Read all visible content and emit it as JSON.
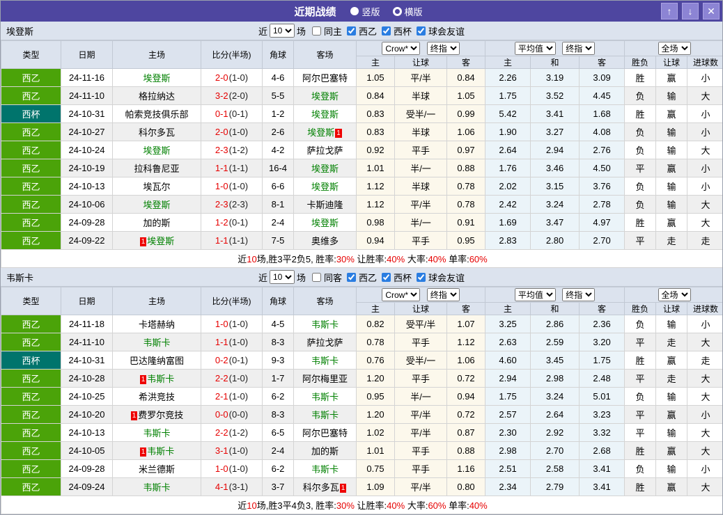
{
  "titlebar": {
    "title": "近期战绩",
    "view_options": [
      {
        "label": "竖版",
        "selected": true
      },
      {
        "label": "横版",
        "selected": false
      }
    ],
    "icons": {
      "up": "↑",
      "down": "↓",
      "close": "✕"
    }
  },
  "colors": {
    "titlebar_purple": "#4e46a0",
    "league_green": "#4ba309",
    "cup_teal": "#00746c",
    "team_highlight_green": "#008000",
    "win_red": "#e60000",
    "draw_green": "#009944",
    "loss_blue": "#2828d0",
    "handicap_col_bg": "#fcf8ec",
    "avg_col_bg": "#ebf4f9"
  },
  "sections": [
    {
      "team": "埃登斯",
      "filter": {
        "near": "近",
        "count": "10",
        "games": "场",
        "same": {
          "label": "同主",
          "checked": false
        },
        "leagues": [
          {
            "label": "西乙",
            "checked": true
          },
          {
            "label": "西杯",
            "checked": true
          },
          {
            "label": "球会友谊",
            "checked": true
          }
        ]
      },
      "columns": {
        "type": "类型",
        "date": "日期",
        "home": "主场",
        "score": "比分(半场)",
        "corner": "角球",
        "away": "客场",
        "crow_select": "Crow*",
        "final_select": "终指",
        "crow_sub": [
          "主",
          "让球",
          "客"
        ],
        "avg_select": "平均值",
        "avg_final_select": "终指",
        "avg_sub": [
          "主",
          "和",
          "客"
        ],
        "scope_select": "全场",
        "result_sub": [
          "胜负",
          "让球",
          "进球数"
        ]
      },
      "rows": [
        {
          "league": "西乙",
          "lc": "green",
          "date": "24-11-16",
          "home": {
            "name": "埃登斯",
            "hl": true
          },
          "score": "2-0",
          "half": "(1-0)",
          "corner": "4-6",
          "away": {
            "name": "阿尔巴塞特",
            "hl": false
          },
          "crow": [
            "1.05",
            "平/半",
            "0.84"
          ],
          "avg": [
            "2.26",
            "3.19",
            "3.09"
          ],
          "result": [
            [
              "胜",
              "r"
            ],
            [
              "赢",
              "r"
            ],
            [
              "小",
              "b"
            ]
          ]
        },
        {
          "league": "西乙",
          "lc": "green",
          "date": "24-11-10",
          "home": {
            "name": "格拉纳达",
            "hl": false
          },
          "score": "3-2",
          "half": "(2-0)",
          "corner": "5-5",
          "away": {
            "name": "埃登斯",
            "hl": true
          },
          "crow": [
            "0.84",
            "半球",
            "1.05"
          ],
          "avg": [
            "1.75",
            "3.52",
            "4.45"
          ],
          "result": [
            [
              "负",
              "b"
            ],
            [
              "输",
              "b"
            ],
            [
              "大",
              "r"
            ]
          ]
        },
        {
          "league": "西杯",
          "lc": "teal",
          "date": "24-10-31",
          "home": {
            "name": "帕索竞技俱乐部",
            "hl": false
          },
          "score": "0-1",
          "half": "(0-1)",
          "corner": "1-2",
          "away": {
            "name": "埃登斯",
            "hl": true
          },
          "crow": [
            "0.83",
            "受半/一",
            "0.99"
          ],
          "avg": [
            "5.42",
            "3.41",
            "1.68"
          ],
          "result": [
            [
              "胜",
              "r"
            ],
            [
              "赢",
              "r"
            ],
            [
              "小",
              "b"
            ]
          ]
        },
        {
          "league": "西乙",
          "lc": "green",
          "date": "24-10-27",
          "home": {
            "name": "科尔多瓦",
            "hl": false
          },
          "score": "2-0",
          "half": "(1-0)",
          "corner": "2-6",
          "away": {
            "name": "埃登斯",
            "hl": true,
            "badge_post": "1"
          },
          "crow": [
            "0.83",
            "半球",
            "1.06"
          ],
          "avg": [
            "1.90",
            "3.27",
            "4.08"
          ],
          "result": [
            [
              "负",
              "b"
            ],
            [
              "输",
              "b"
            ],
            [
              "小",
              "b"
            ]
          ]
        },
        {
          "league": "西乙",
          "lc": "green",
          "date": "24-10-24",
          "home": {
            "name": "埃登斯",
            "hl": true
          },
          "score": "2-3",
          "half": "(1-2)",
          "corner": "4-2",
          "away": {
            "name": "萨拉戈萨",
            "hl": false
          },
          "crow": [
            "0.92",
            "平手",
            "0.97"
          ],
          "avg": [
            "2.64",
            "2.94",
            "2.76"
          ],
          "result": [
            [
              "负",
              "b"
            ],
            [
              "输",
              "b"
            ],
            [
              "大",
              "r"
            ]
          ]
        },
        {
          "league": "西乙",
          "lc": "green",
          "date": "24-10-19",
          "home": {
            "name": "拉科鲁尼亚",
            "hl": false
          },
          "score": "1-1",
          "half": "(1-1)",
          "corner": "16-4",
          "away": {
            "name": "埃登斯",
            "hl": true
          },
          "crow": [
            "1.01",
            "半/一",
            "0.88"
          ],
          "avg": [
            "1.76",
            "3.46",
            "4.50"
          ],
          "result": [
            [
              "平",
              "g"
            ],
            [
              "赢",
              "r"
            ],
            [
              "小",
              "b"
            ]
          ]
        },
        {
          "league": "西乙",
          "lc": "green",
          "date": "24-10-13",
          "home": {
            "name": "埃瓦尔",
            "hl": false
          },
          "score": "1-0",
          "half": "(1-0)",
          "corner": "6-6",
          "away": {
            "name": "埃登斯",
            "hl": true
          },
          "crow": [
            "1.12",
            "半球",
            "0.78"
          ],
          "avg": [
            "2.02",
            "3.15",
            "3.76"
          ],
          "result": [
            [
              "负",
              "b"
            ],
            [
              "输",
              "b"
            ],
            [
              "小",
              "b"
            ]
          ]
        },
        {
          "league": "西乙",
          "lc": "green",
          "date": "24-10-06",
          "home": {
            "name": "埃登斯",
            "hl": true
          },
          "score": "2-3",
          "half": "(2-3)",
          "corner": "8-1",
          "away": {
            "name": "卡斯迪隆",
            "hl": false
          },
          "crow": [
            "1.12",
            "平/半",
            "0.78"
          ],
          "avg": [
            "2.42",
            "3.24",
            "2.78"
          ],
          "result": [
            [
              "负",
              "b"
            ],
            [
              "输",
              "b"
            ],
            [
              "大",
              "r"
            ]
          ]
        },
        {
          "league": "西乙",
          "lc": "green",
          "date": "24-09-28",
          "home": {
            "name": "加的斯",
            "hl": false
          },
          "score": "1-2",
          "half": "(0-1)",
          "corner": "2-4",
          "away": {
            "name": "埃登斯",
            "hl": true
          },
          "crow": [
            "0.98",
            "半/一",
            "0.91"
          ],
          "avg": [
            "1.69",
            "3.47",
            "4.97"
          ],
          "result": [
            [
              "胜",
              "r"
            ],
            [
              "赢",
              "r"
            ],
            [
              "大",
              "r"
            ]
          ]
        },
        {
          "league": "西乙",
          "lc": "green",
          "date": "24-09-22",
          "home": {
            "name": "埃登斯",
            "hl": true,
            "badge_pre": "1"
          },
          "score": "1-1",
          "half": "(1-1)",
          "corner": "7-5",
          "away": {
            "name": "奥维多",
            "hl": false
          },
          "crow": [
            "0.94",
            "平手",
            "0.95"
          ],
          "avg": [
            "2.83",
            "2.80",
            "2.70"
          ],
          "result": [
            [
              "平",
              "g"
            ],
            [
              "走",
              "g"
            ],
            [
              "走",
              "g"
            ]
          ]
        }
      ],
      "summary": [
        [
          "近",
          "k"
        ],
        [
          "10",
          "r"
        ],
        [
          "场,胜3平2负5, 胜率:",
          "k"
        ],
        [
          "30%",
          "r"
        ],
        [
          " 让胜率:",
          "k"
        ],
        [
          "40%",
          "r"
        ],
        [
          " 大率:",
          "k"
        ],
        [
          "40%",
          "r"
        ],
        [
          " 单率:",
          "k"
        ],
        [
          "60%",
          "r"
        ]
      ]
    },
    {
      "team": "韦斯卡",
      "filter": {
        "near": "近",
        "count": "10",
        "games": "场",
        "same": {
          "label": "同客",
          "checked": false
        },
        "leagues": [
          {
            "label": "西乙",
            "checked": true
          },
          {
            "label": "西杯",
            "checked": true
          },
          {
            "label": "球会友谊",
            "checked": true
          }
        ]
      },
      "columns": {
        "type": "类型",
        "date": "日期",
        "home": "主场",
        "score": "比分(半场)",
        "corner": "角球",
        "away": "客场",
        "crow_select": "Crow*",
        "final_select": "终指",
        "crow_sub": [
          "主",
          "让球",
          "客"
        ],
        "avg_select": "平均值",
        "avg_final_select": "终指",
        "avg_sub": [
          "主",
          "和",
          "客"
        ],
        "scope_select": "全场",
        "result_sub": [
          "胜负",
          "让球",
          "进球数"
        ]
      },
      "rows": [
        {
          "league": "西乙",
          "lc": "green",
          "date": "24-11-18",
          "home": {
            "name": "卡塔赫纳",
            "hl": false
          },
          "score": "1-0",
          "half": "(1-0)",
          "corner": "4-5",
          "away": {
            "name": "韦斯卡",
            "hl": true
          },
          "crow": [
            "0.82",
            "受平/半",
            "1.07"
          ],
          "avg": [
            "3.25",
            "2.86",
            "2.36"
          ],
          "result": [
            [
              "负",
              "b"
            ],
            [
              "输",
              "b"
            ],
            [
              "小",
              "b"
            ]
          ]
        },
        {
          "league": "西乙",
          "lc": "green",
          "date": "24-11-10",
          "home": {
            "name": "韦斯卡",
            "hl": true
          },
          "score": "1-1",
          "half": "(1-0)",
          "corner": "8-3",
          "away": {
            "name": "萨拉戈萨",
            "hl": false
          },
          "crow": [
            "0.78",
            "平手",
            "1.12"
          ],
          "avg": [
            "2.63",
            "2.59",
            "3.20"
          ],
          "result": [
            [
              "平",
              "g"
            ],
            [
              "走",
              "g"
            ],
            [
              "大",
              "r"
            ]
          ]
        },
        {
          "league": "西杯",
          "lc": "teal",
          "date": "24-10-31",
          "home": {
            "name": "巴达隆纳富图",
            "hl": false
          },
          "score": "0-2",
          "half": "(0-1)",
          "corner": "9-3",
          "away": {
            "name": "韦斯卡",
            "hl": true
          },
          "crow": [
            "0.76",
            "受半/一",
            "1.06"
          ],
          "avg": [
            "4.60",
            "3.45",
            "1.75"
          ],
          "result": [
            [
              "胜",
              "r"
            ],
            [
              "赢",
              "r"
            ],
            [
              "走",
              "g"
            ]
          ]
        },
        {
          "league": "西乙",
          "lc": "green",
          "date": "24-10-28",
          "home": {
            "name": "韦斯卡",
            "hl": true,
            "badge_pre": "1"
          },
          "score": "2-2",
          "half": "(1-0)",
          "corner": "1-7",
          "away": {
            "name": "阿尔梅里亚",
            "hl": false
          },
          "crow": [
            "1.20",
            "平手",
            "0.72"
          ],
          "avg": [
            "2.94",
            "2.98",
            "2.48"
          ],
          "result": [
            [
              "平",
              "g"
            ],
            [
              "走",
              "g"
            ],
            [
              "大",
              "r"
            ]
          ]
        },
        {
          "league": "西乙",
          "lc": "green",
          "date": "24-10-25",
          "home": {
            "name": "希洪竞技",
            "hl": false
          },
          "score": "2-1",
          "half": "(1-0)",
          "corner": "6-2",
          "away": {
            "name": "韦斯卡",
            "hl": true
          },
          "crow": [
            "0.95",
            "半/一",
            "0.94"
          ],
          "avg": [
            "1.75",
            "3.24",
            "5.01"
          ],
          "result": [
            [
              "负",
              "b"
            ],
            [
              "输",
              "b"
            ],
            [
              "大",
              "r"
            ]
          ]
        },
        {
          "league": "西乙",
          "lc": "green",
          "date": "24-10-20",
          "home": {
            "name": "费罗尔竞技",
            "hl": false,
            "badge_pre": "1"
          },
          "score": "0-0",
          "half": "(0-0)",
          "corner": "8-3",
          "away": {
            "name": "韦斯卡",
            "hl": true
          },
          "crow": [
            "1.20",
            "平/半",
            "0.72"
          ],
          "avg": [
            "2.57",
            "2.64",
            "3.23"
          ],
          "result": [
            [
              "平",
              "g"
            ],
            [
              "赢",
              "r"
            ],
            [
              "小",
              "b"
            ]
          ]
        },
        {
          "league": "西乙",
          "lc": "green",
          "date": "24-10-13",
          "home": {
            "name": "韦斯卡",
            "hl": true
          },
          "score": "2-2",
          "half": "(1-2)",
          "corner": "6-5",
          "away": {
            "name": "阿尔巴塞特",
            "hl": false
          },
          "crow": [
            "1.02",
            "平/半",
            "0.87"
          ],
          "avg": [
            "2.30",
            "2.92",
            "3.32"
          ],
          "result": [
            [
              "平",
              "g"
            ],
            [
              "输",
              "b"
            ],
            [
              "大",
              "r"
            ]
          ]
        },
        {
          "league": "西乙",
          "lc": "green",
          "date": "24-10-05",
          "home": {
            "name": "韦斯卡",
            "hl": true,
            "badge_pre": "1"
          },
          "score": "3-1",
          "half": "(1-0)",
          "corner": "2-4",
          "away": {
            "name": "加的斯",
            "hl": false
          },
          "crow": [
            "1.01",
            "平手",
            "0.88"
          ],
          "avg": [
            "2.98",
            "2.70",
            "2.68"
          ],
          "result": [
            [
              "胜",
              "r"
            ],
            [
              "赢",
              "r"
            ],
            [
              "大",
              "r"
            ]
          ]
        },
        {
          "league": "西乙",
          "lc": "green",
          "date": "24-09-28",
          "home": {
            "name": "米兰德斯",
            "hl": false
          },
          "score": "1-0",
          "half": "(1-0)",
          "corner": "6-2",
          "away": {
            "name": "韦斯卡",
            "hl": true
          },
          "crow": [
            "0.75",
            "平手",
            "1.16"
          ],
          "avg": [
            "2.51",
            "2.58",
            "3.41"
          ],
          "result": [
            [
              "负",
              "b"
            ],
            [
              "输",
              "b"
            ],
            [
              "小",
              "b"
            ]
          ]
        },
        {
          "league": "西乙",
          "lc": "green",
          "date": "24-09-24",
          "home": {
            "name": "韦斯卡",
            "hl": true
          },
          "score": "4-1",
          "half": "(3-1)",
          "corner": "3-7",
          "away": {
            "name": "科尔多瓦",
            "hl": false,
            "badge_post": "1"
          },
          "crow": [
            "1.09",
            "平/半",
            "0.80"
          ],
          "avg": [
            "2.34",
            "2.79",
            "3.41"
          ],
          "result": [
            [
              "胜",
              "r"
            ],
            [
              "赢",
              "r"
            ],
            [
              "大",
              "r"
            ]
          ]
        }
      ],
      "summary": [
        [
          "近",
          "k"
        ],
        [
          "10",
          "r"
        ],
        [
          "场,胜3平4负3, 胜率:",
          "k"
        ],
        [
          "30%",
          "r"
        ],
        [
          " 让胜率:",
          "k"
        ],
        [
          "40%",
          "r"
        ],
        [
          " 大率:",
          "k"
        ],
        [
          "60%",
          "r"
        ],
        [
          " 单率:",
          "k"
        ],
        [
          "40%",
          "r"
        ]
      ]
    }
  ]
}
